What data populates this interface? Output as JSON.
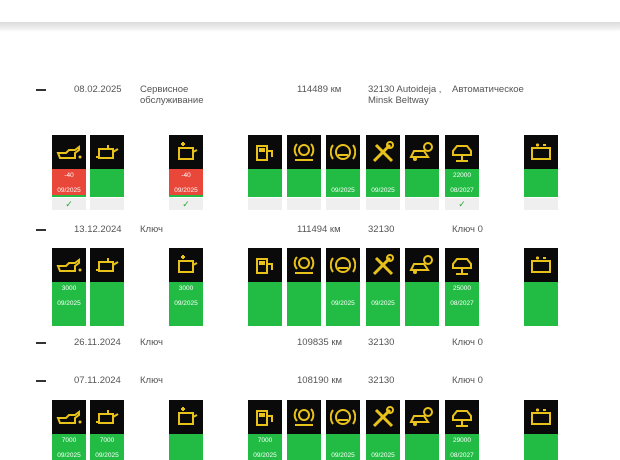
{
  "entries": [
    {
      "date": "08.02.2025",
      "type": "Сервисное обслуживание",
      "km": "114489 км",
      "code": "32130 Autoideja , Minsk Beltway",
      "mode": "Автоматическое"
    },
    {
      "date": "13.12.2024",
      "type": "Ключ",
      "km": "111494 км",
      "code": "32130",
      "mode": "Ключ 0"
    },
    {
      "date": "26.11.2024",
      "type": "Ключ",
      "km": "109835 км",
      "code": "32130",
      "mode": "Ключ 0"
    },
    {
      "date": "07.11.2024",
      "type": "Ключ",
      "km": "108190 км",
      "code": "32130",
      "mode": "Ключ 0"
    }
  ],
  "tiles_row1": [
    {
      "icon": "oil-can-icon",
      "v1": "-40",
      "v2": "09/2025",
      "red": true,
      "check": "✓"
    },
    {
      "icon": "oil-level-icon",
      "v1": "",
      "v2": "",
      "red": false,
      "check": ""
    },
    {
      "icon": "oil-filter-icon",
      "v1": "-40",
      "v2": "09/2025",
      "red": true,
      "check": "✓"
    },
    {
      "icon": "fuel-filter-icon",
      "v1": "",
      "v2": "",
      "red": false,
      "check": ""
    },
    {
      "icon": "brake-service-icon",
      "v1": "",
      "v2": "",
      "red": false,
      "check": ""
    },
    {
      "icon": "brake-fluid-icon",
      "v1": "",
      "v2": "09/2025",
      "red": false,
      "check": ""
    },
    {
      "icon": "tools-icon",
      "v1": "",
      "v2": "09/2025",
      "red": false,
      "check": ""
    },
    {
      "icon": "car-brake-icon",
      "v1": "",
      "v2": "",
      "red": false,
      "check": ""
    },
    {
      "icon": "lift-icon",
      "v1": "22000",
      "v2": "08/2027",
      "red": false,
      "check": "✓"
    },
    {
      "icon": "battery-icon",
      "v1": "",
      "v2": "",
      "red": false,
      "check": ""
    }
  ],
  "tiles_row2": [
    {
      "icon": "oil-can-icon",
      "v1": "3000",
      "v2": "09/2025"
    },
    {
      "icon": "oil-level-icon",
      "v1": "",
      "v2": ""
    },
    {
      "icon": "oil-filter-icon",
      "v1": "3000",
      "v2": "09/2025"
    },
    {
      "icon": "fuel-filter-icon",
      "v1": "",
      "v2": ""
    },
    {
      "icon": "brake-service-icon",
      "v1": "",
      "v2": ""
    },
    {
      "icon": "brake-fluid-icon",
      "v1": "",
      "v2": "09/2025"
    },
    {
      "icon": "tools-icon",
      "v1": "",
      "v2": "09/2025"
    },
    {
      "icon": "car-brake-icon",
      "v1": "",
      "v2": ""
    },
    {
      "icon": "lift-icon",
      "v1": "25000",
      "v2": "08/2027"
    },
    {
      "icon": "battery-icon",
      "v1": "",
      "v2": ""
    }
  ],
  "tiles_row3": [
    {
      "icon": "oil-can-icon",
      "v1": "7000",
      "v2": "09/2025"
    },
    {
      "icon": "oil-level-icon",
      "v1": "7000",
      "v2": "09/2025"
    },
    {
      "icon": "oil-filter-icon",
      "v1": "",
      "v2": ""
    },
    {
      "icon": "fuel-filter-icon",
      "v1": "7000",
      "v2": "09/2025"
    },
    {
      "icon": "brake-service-icon",
      "v1": "",
      "v2": ""
    },
    {
      "icon": "brake-fluid-icon",
      "v1": "",
      "v2": "09/2025"
    },
    {
      "icon": "tools-icon",
      "v1": "",
      "v2": "09/2025"
    },
    {
      "icon": "car-brake-icon",
      "v1": "",
      "v2": ""
    },
    {
      "icon": "lift-icon",
      "v1": "29000",
      "v2": "08/2027"
    },
    {
      "icon": "battery-icon",
      "v1": "",
      "v2": ""
    }
  ],
  "colors": {
    "green": "#22bb44",
    "red": "#e8473a",
    "icon_bg": "#0a0a0a",
    "icon_fg": "#e8c21a"
  }
}
